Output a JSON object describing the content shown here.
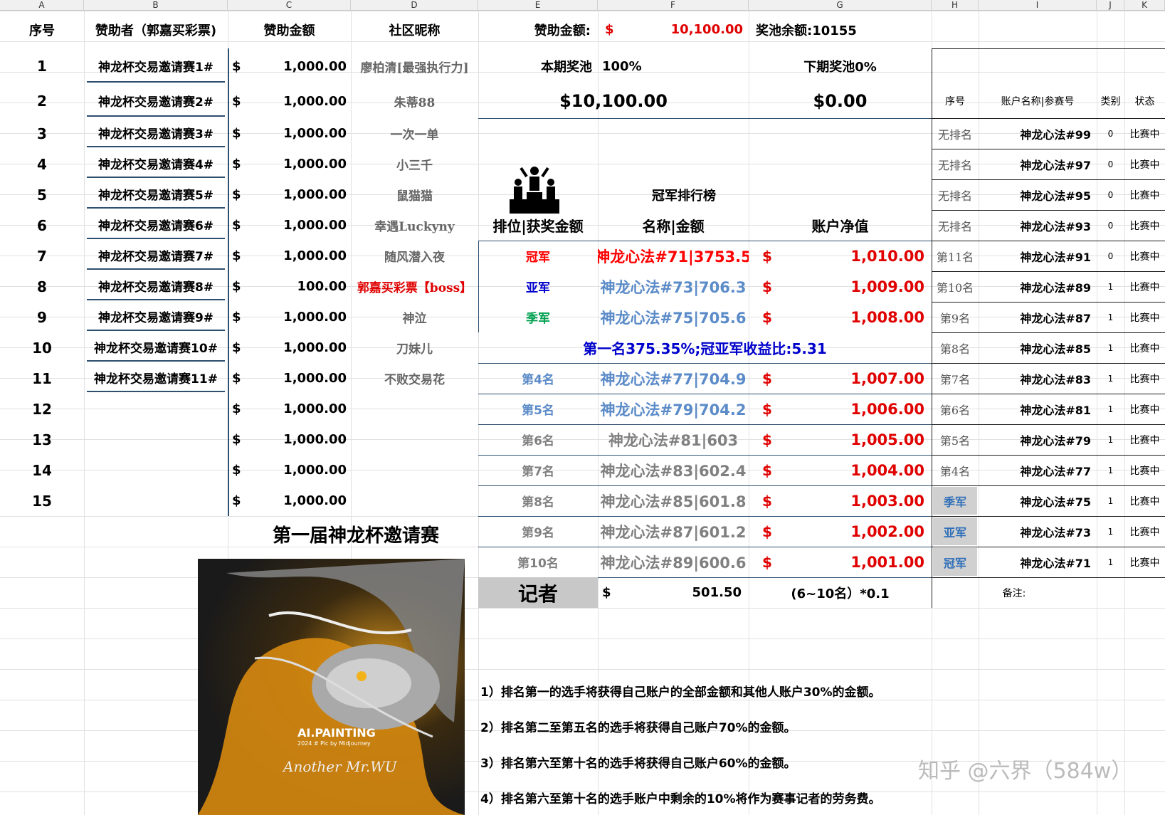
{
  "columns": [
    "A",
    "B",
    "C",
    "D",
    "E",
    "F",
    "G",
    "H",
    "I",
    "J",
    "K"
  ],
  "left": {
    "headers": {
      "seq": "序号",
      "sponsor": "赞助者（郭嘉买彩票)",
      "amount": "赞助金额",
      "nick": "社区昵称"
    },
    "rows": [
      {
        "n": "1",
        "sponsor": "神龙杯交易邀请赛1#",
        "cur": "$",
        "amt": "1,000.00",
        "nick": "廖柏清[最强执行力]"
      },
      {
        "n": "2",
        "sponsor": "神龙杯交易邀请赛2#",
        "cur": "$",
        "amt": "1,000.00",
        "nick": "朱蒂88"
      },
      {
        "n": "3",
        "sponsor": "神龙杯交易邀请赛3#",
        "cur": "$",
        "amt": "1,000.00",
        "nick": "一次一单"
      },
      {
        "n": "4",
        "sponsor": "神龙杯交易邀请赛4#",
        "cur": "$",
        "amt": "1,000.00",
        "nick": "小三千"
      },
      {
        "n": "5",
        "sponsor": "神龙杯交易邀请赛5#",
        "cur": "$",
        "amt": "1,000.00",
        "nick": "鼠猫猫"
      },
      {
        "n": "6",
        "sponsor": "神龙杯交易邀请赛6#",
        "cur": "$",
        "amt": "1,000.00",
        "nick": "幸遇Luckyny"
      },
      {
        "n": "7",
        "sponsor": "神龙杯交易邀请赛7#",
        "cur": "$",
        "amt": "1,000.00",
        "nick": "随风潜入夜"
      },
      {
        "n": "8",
        "sponsor": "神龙杯交易邀请赛8#",
        "cur": "$",
        "amt": "100.00",
        "nick": "郭嘉买彩票【boss】"
      },
      {
        "n": "9",
        "sponsor": "神龙杯交易邀请赛9#",
        "cur": "$",
        "amt": "1,000.00",
        "nick": "神泣"
      },
      {
        "n": "10",
        "sponsor": "神龙杯交易邀请赛10#",
        "cur": "$",
        "amt": "1,000.00",
        "nick": "刀妹儿"
      },
      {
        "n": "11",
        "sponsor": "神龙杯交易邀请赛11#",
        "cur": "$",
        "amt": "1,000.00",
        "nick": "不败交易花"
      },
      {
        "n": "12",
        "sponsor": "",
        "cur": "$",
        "amt": "1,000.00",
        "nick": ""
      },
      {
        "n": "13",
        "sponsor": "",
        "cur": "$",
        "amt": "1,000.00",
        "nick": ""
      },
      {
        "n": "14",
        "sponsor": "",
        "cur": "$",
        "amt": "1,000.00",
        "nick": ""
      },
      {
        "n": "15",
        "sponsor": "",
        "cur": "$",
        "amt": "1,000.00",
        "nick": ""
      }
    ],
    "event_title": "第一届神龙杯邀请赛"
  },
  "poster": {
    "line1": "AI.PAINTING",
    "line2": "2024 # Pic by Midjourney",
    "signature": "Another Mr.WU"
  },
  "top": {
    "sponsor_label": "赞助金额:",
    "sponsor_cur": "$",
    "sponsor_total": "10,100.00",
    "pool_balance": "奖池余额:10155",
    "this_pool_label": "本期奖池",
    "this_pool_pct": "100%",
    "next_pool": "下期奖池0%",
    "this_pool_amt": "$10,100.00",
    "next_pool_amt": "$0.00"
  },
  "board": {
    "title": "冠军排行榜",
    "headers": {
      "rank": "排位|获奖金额",
      "name": "名称|金额",
      "equity": "账户净值"
    },
    "rows": [
      {
        "rank": "冠军",
        "name": "神龙心法#71|3753.5",
        "cur": "$",
        "eq": "1,010.00",
        "color": "#ff0000"
      },
      {
        "rank": "亚军",
        "name": "神龙心法#73|706.3",
        "cur": "$",
        "eq": "1,009.00",
        "color": "#0000cc"
      },
      {
        "rank": "季军",
        "name": "神龙心法#75|705.6",
        "cur": "$",
        "eq": "1,008.00",
        "color": "#00a050"
      }
    ],
    "summary": "第一名375.35%;冠亚军收益比:5.31",
    "rows2": [
      {
        "rank": "第4名",
        "name": "神龙心法#77|704.9",
        "cur": "$",
        "eq": "1,007.00",
        "color": "#5b8bc8"
      },
      {
        "rank": "第5名",
        "name": "神龙心法#79|704.2",
        "cur": "$",
        "eq": "1,006.00",
        "color": "#5b8bc8"
      },
      {
        "rank": "第6名",
        "name": "神龙心法#81|603",
        "cur": "$",
        "eq": "1,005.00",
        "color": "#808080"
      },
      {
        "rank": "第7名",
        "name": "神龙心法#83|602.4",
        "cur": "$",
        "eq": "1,004.00",
        "color": "#808080"
      },
      {
        "rank": "第8名",
        "name": "神龙心法#85|601.8",
        "cur": "$",
        "eq": "1,003.00",
        "color": "#808080"
      },
      {
        "rank": "第9名",
        "name": "神龙心法#87|601.2",
        "cur": "$",
        "eq": "1,002.00",
        "color": "#808080"
      },
      {
        "rank": "第10名",
        "name": "神龙心法#89|600.6",
        "cur": "$",
        "eq": "1,001.00",
        "color": "#808080"
      }
    ],
    "reporter": {
      "label": "记者",
      "cur": "$",
      "amt": "501.50",
      "note": "(6~10名）*0.1"
    }
  },
  "status": {
    "headers": {
      "seq": "序号",
      "acct": "账户名称|参赛号",
      "type": "类别",
      "state": "状态"
    },
    "rows": [
      {
        "rank": "无排名",
        "acct": "神龙心法#99",
        "type": "0",
        "state": "比赛中"
      },
      {
        "rank": "无排名",
        "acct": "神龙心法#97",
        "type": "0",
        "state": "比赛中"
      },
      {
        "rank": "无排名",
        "acct": "神龙心法#95",
        "type": "0",
        "state": "比赛中"
      },
      {
        "rank": "无排名",
        "acct": "神龙心法#93",
        "type": "0",
        "state": "比赛中"
      },
      {
        "rank": "第11名",
        "acct": "神龙心法#91",
        "type": "0",
        "state": "比赛中"
      },
      {
        "rank": "第10名",
        "acct": "神龙心法#89",
        "type": "1",
        "state": "比赛中"
      },
      {
        "rank": "第9名",
        "acct": "神龙心法#87",
        "type": "1",
        "state": "比赛中"
      },
      {
        "rank": "第8名",
        "acct": "神龙心法#85",
        "type": "1",
        "state": "比赛中"
      },
      {
        "rank": "第7名",
        "acct": "神龙心法#83",
        "type": "1",
        "state": "比赛中"
      },
      {
        "rank": "第6名",
        "acct": "神龙心法#81",
        "type": "1",
        "state": "比赛中"
      },
      {
        "rank": "第5名",
        "acct": "神龙心法#79",
        "type": "1",
        "state": "比赛中"
      },
      {
        "rank": "第4名",
        "acct": "神龙心法#77",
        "type": "1",
        "state": "比赛中"
      },
      {
        "rank": "季军",
        "acct": "神龙心法#75",
        "type": "1",
        "state": "比赛中",
        "special": true
      },
      {
        "rank": "亚军",
        "acct": "神龙心法#73",
        "type": "1",
        "state": "比赛中",
        "special": true
      },
      {
        "rank": "冠军",
        "acct": "神龙心法#71",
        "type": "1",
        "state": "比赛中",
        "special": true
      }
    ],
    "note_label": "备注:"
  },
  "rules": [
    "1）排名第一的选手将获得自己账户的全部金额和其他人账户30%的金额。",
    "2）排名第二至第五名的选手将获得自己账户70%的金额。",
    "3）排名第六至第十名的选手将获得自己账户60%的金额。",
    "4）排名第六至第十名的选手账户中剩余的10%将作为赛事记者的劳务费。"
  ],
  "watermark": "知乎 @六界（584w）"
}
